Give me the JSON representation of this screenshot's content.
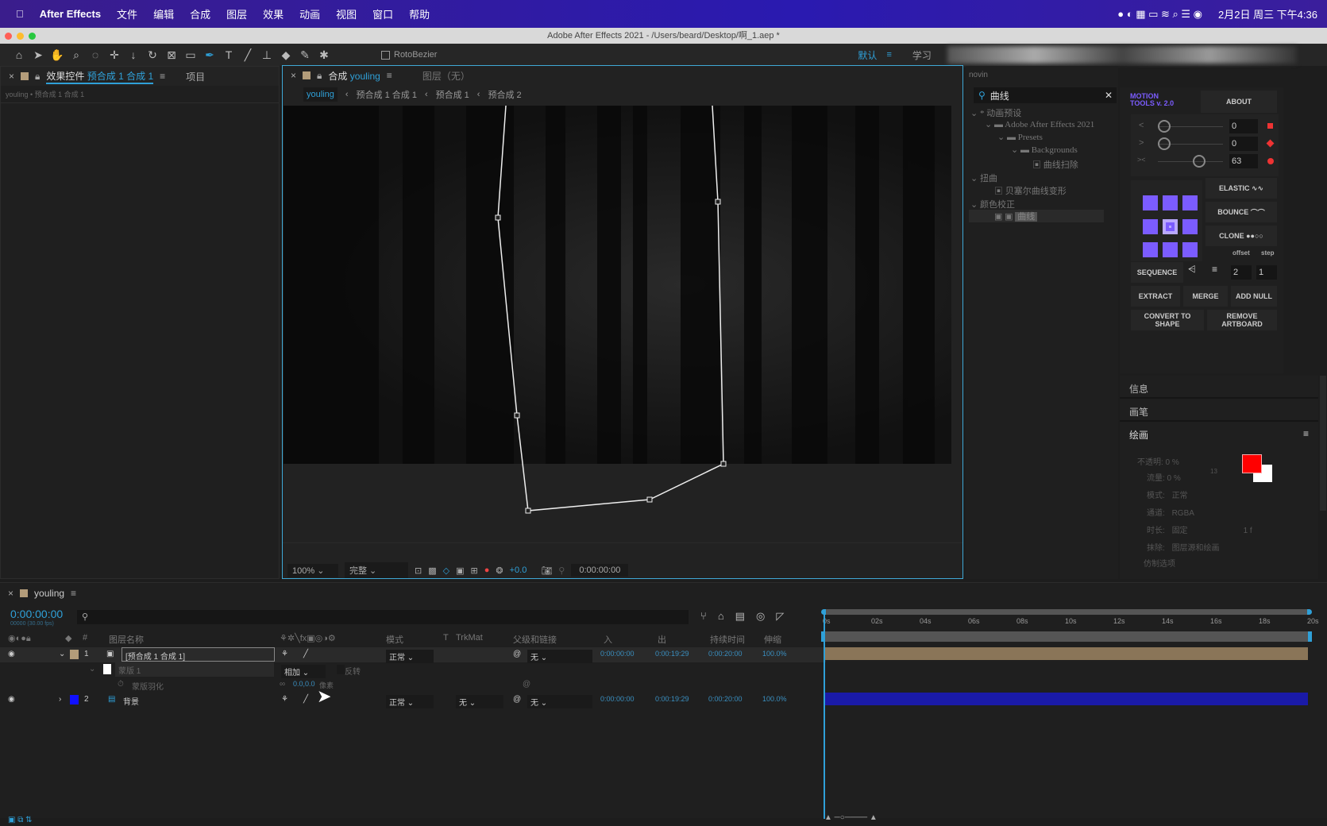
{
  "menubar": {
    "app": "After Effects",
    "items": [
      "文件",
      "编辑",
      "合成",
      "图层",
      "效果",
      "动画",
      "视图",
      "窗口",
      "帮助"
    ],
    "clock": "2月2日 周三 下午4:36"
  },
  "window": {
    "title": "Adobe After Effects 2021 - /Users/beard/Desktop/啊_1.aep *"
  },
  "toolbar": {
    "rotobezier": "RotoBezier",
    "workspace": "默认",
    "learn": "学习"
  },
  "effects_panel": {
    "tab": "效果控件",
    "tab_target": "预合成 1 合成 1",
    "project_tab": "项目",
    "breadcrumb": "youling • 预合成 1 合成 1"
  },
  "comp_panel": {
    "tab_prefix": "合成",
    "tab_name": "youling",
    "layer_tab": "图层（无）",
    "breadcrumbs": [
      "youling",
      "预合成 1 合成 1",
      "预合成 1",
      "预合成 2"
    ],
    "zoom": "100%",
    "quality": "完整",
    "exposure": "+0.0",
    "timecode": "0:00:00:00"
  },
  "presets": {
    "header": "novin",
    "search": "曲线",
    "tree": [
      "* 动画预设",
      "Adobe After Effects 2021",
      "Presets",
      "Backgrounds",
      "曲线扫除",
      "扭曲",
      "贝塞尔曲线变形",
      "颜色校正",
      "曲线"
    ]
  },
  "motion_tools": {
    "title": "MOTION TOOLS v. 2.0",
    "about": "ABOUT",
    "sliders": [
      {
        "icon": "<",
        "value": "0"
      },
      {
        "icon": ">",
        "value": "0"
      },
      {
        "icon": "><",
        "value": "63"
      }
    ],
    "slider_positions": [
      0,
      0,
      0.63
    ],
    "elastic": "ELASTIC",
    "bounce": "BOUNCE",
    "clone": "CLONE",
    "offset": "offset",
    "step": "step",
    "sequence": "SEQUENCE",
    "offset_value": "2",
    "step_value": "1",
    "extract": "EXTRACT",
    "merge": "MERGE",
    "add_null": "ADD NULL",
    "convert": "CONVERT TO SHAPE",
    "remove_artboard": "REMOVE ARTBOARD",
    "accent": "#7b5cff"
  },
  "side_panels": {
    "info": "信息",
    "brush": "画笔",
    "paint": "绘画",
    "opacity": "不透明: 0 %",
    "flow": "流量: 0 %",
    "mode_label": "模式:",
    "mode": "正常",
    "channel_label": "通道:",
    "channel": "RGBA",
    "duration_label": "时长:",
    "duration": "固定",
    "frames": "1 f",
    "erase_label": "抹除:",
    "erase": "图层源和绘画",
    "clone_options": "仿制选项",
    "brush_size": "13",
    "fg_color": "#ff0000",
    "bg_color": "#ffffff"
  },
  "timeline": {
    "tab": "youling",
    "timecode": "0:00:00:00",
    "fps": "00000 (30.00 fps)",
    "headers": {
      "name": "图层名称",
      "mode": "模式",
      "t": "T",
      "trkmat": "TrkMat",
      "parent": "父级和链接",
      "in": "入",
      "out": "出",
      "duration": "持续时间",
      "stretch": "伸缩",
      "num": "#"
    },
    "ruler": [
      "0s",
      "02s",
      "04s",
      "06s",
      "08s",
      "10s",
      "12s",
      "14s",
      "16s",
      "18s",
      "20s"
    ],
    "layers": [
      {
        "num": "1",
        "name": "[预合成 1 合成 1]",
        "mode": "正常",
        "parent": "无",
        "in": "0:00:00:00",
        "out": "0:00:19:29",
        "duration": "0:00:20:00",
        "stretch": "100.0%",
        "color": "#b39c7a",
        "bar": "#8a7558"
      },
      {
        "num": "2",
        "name": "背景",
        "mode": "正常",
        "trkmat": "无",
        "parent": "无",
        "in": "0:00:00:00",
        "out": "0:00:19:29",
        "duration": "0:00:20:00",
        "stretch": "100.0%",
        "color": "#1010ff",
        "bar": "#1a1aa8"
      }
    ],
    "mask": {
      "name": "蒙版 1",
      "mode": "相加",
      "invert": "反转",
      "feather_label": "蒙版羽化",
      "feather_value": "0.0,0.0",
      "feather_unit": "像素"
    }
  }
}
